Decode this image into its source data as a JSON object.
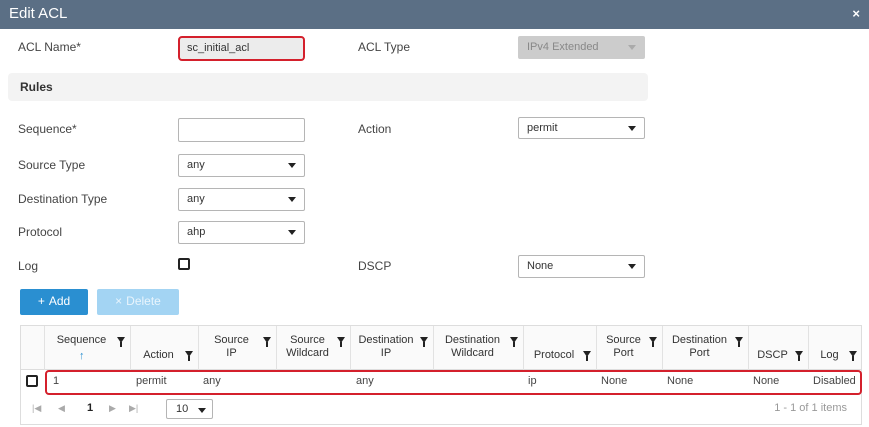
{
  "dialog": {
    "title": "Edit ACL",
    "close": "×"
  },
  "form": {
    "acl_name_label": "ACL Name*",
    "acl_name_value": "sc_initial_acl",
    "acl_type_label": "ACL Type",
    "acl_type_value": "IPv4 Extended",
    "rules_heading": "Rules",
    "sequence_label": "Sequence*",
    "sequence_value": "",
    "action_label": "Action",
    "action_value": "permit",
    "source_type_label": "Source Type",
    "source_type_value": "any",
    "destination_type_label": "Destination Type",
    "destination_type_value": "any",
    "protocol_label": "Protocol",
    "protocol_value": "ahp",
    "log_label": "Log",
    "log_checked": false,
    "dscp_label": "DSCP",
    "dscp_value": "None"
  },
  "buttons": {
    "add": "Add",
    "add_icon": "+",
    "delete": "Delete",
    "delete_icon": "×"
  },
  "table": {
    "columns": [
      {
        "l1": "Sequence",
        "l2": ""
      },
      {
        "l1": "",
        "l2": "Action"
      },
      {
        "l1": "Source",
        "l2": "IP"
      },
      {
        "l1": "Source",
        "l2": "Wildcard"
      },
      {
        "l1": "Destination",
        "l2": "IP"
      },
      {
        "l1": "Destination",
        "l2": "Wildcard"
      },
      {
        "l1": "",
        "l2": "Protocol"
      },
      {
        "l1": "Source",
        "l2": "Port"
      },
      {
        "l1": "Destination",
        "l2": "Port"
      },
      {
        "l1": "",
        "l2": "DSCP"
      },
      {
        "l1": "",
        "l2": "Log"
      }
    ],
    "sort_indicator": "↑",
    "rows": [
      [
        "1",
        "permit",
        "any",
        "",
        "any",
        "",
        "ip",
        "None",
        "None",
        "None",
        "Disabled"
      ]
    ]
  },
  "pager": {
    "first": "|◀",
    "prev": "◀",
    "current_page": "1",
    "next": "▶",
    "last": "▶|",
    "page_size": "10",
    "summary": "1 - 1 of 1 items"
  }
}
